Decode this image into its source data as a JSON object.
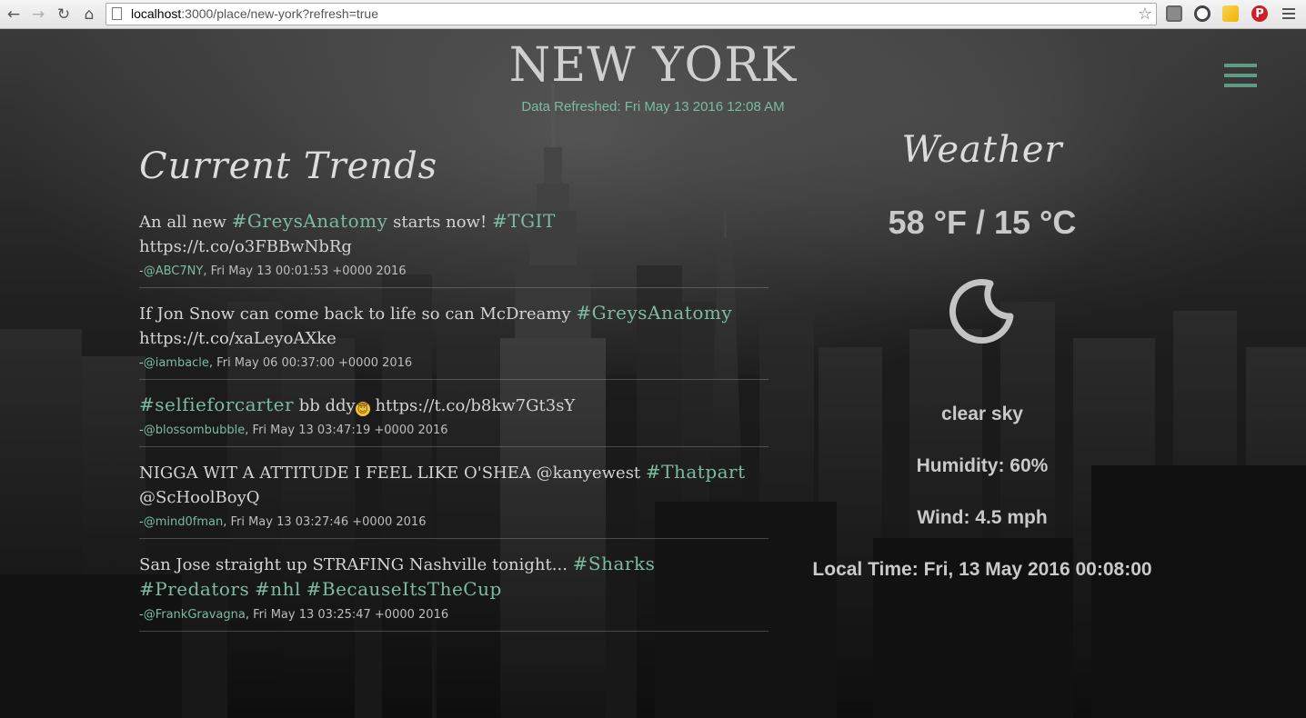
{
  "browser": {
    "url_host": "localhost",
    "url_path": ":3000/place/new-york?refresh=true",
    "back_icon": "arrow-left",
    "forward_icon": "arrow-right",
    "reload_icon": "reload",
    "home_icon": "home",
    "star_icon": "star-outline"
  },
  "header": {
    "city": "NEW YORK",
    "refreshed": "Data Refreshed: Fri May 13 2016 12:08 AM"
  },
  "trends": {
    "heading": "Current Trends",
    "tweets": [
      {
        "parts": [
          {
            "t": "An all new "
          },
          {
            "t": "#GreysAnatomy",
            "tag": true
          },
          {
            "t": " starts now! "
          },
          {
            "t": "#TGIT",
            "tag": true
          },
          {
            "t": " https://t.co/o3FBBwNbRg"
          }
        ],
        "user": "@ABC7NY",
        "date": ", Fri May 13 00:01:53 +0000 2016"
      },
      {
        "parts": [
          {
            "t": "If Jon Snow can come back to life so can McDreamy "
          },
          {
            "t": "#GreysAnatomy",
            "tag": true
          },
          {
            "t": " https://t.co/xaLeyoAXke"
          }
        ],
        "user": "@iambacle",
        "date": ", Fri May 06 00:37:00 +0000 2016"
      },
      {
        "parts": [
          {
            "t": "#selfieforcarter",
            "tag": true
          },
          {
            "t": " bb ddy"
          },
          {
            "t": "😇",
            "emoji": true
          },
          {
            "t": " https://t.co/b8kw7Gt3sY"
          }
        ],
        "user": "@blossombubble",
        "date": ", Fri May 13 03:47:19 +0000 2016"
      },
      {
        "parts": [
          {
            "t": "NIGGA WIT A ATTITUDE I FEEL LIKE O'SHEA @kanyewest "
          },
          {
            "t": "#Thatpart",
            "tag": true
          },
          {
            "t": " @ScHoolBoyQ"
          }
        ],
        "user": "@mind0fman",
        "date": ", Fri May 13 03:27:46 +0000 2016"
      },
      {
        "parts": [
          {
            "t": "San Jose straight up STRAFING Nashville tonight... "
          },
          {
            "t": "#Sharks",
            "tag": true
          },
          {
            "t": " "
          },
          {
            "t": "#Predators",
            "tag": true
          },
          {
            "t": " "
          },
          {
            "t": "#nhl",
            "tag": true
          },
          {
            "t": " "
          },
          {
            "t": "#BecauseItsTheCup",
            "tag": true
          }
        ],
        "user": "@FrankGravagna",
        "date": ", Fri May 13 03:25:47 +0000 2016"
      }
    ]
  },
  "weather": {
    "heading": "Weather",
    "temp": "58 °F / 15 °C",
    "icon": "moon-crescent-icon",
    "condition": "clear sky",
    "humidity": "Humidity: 60%",
    "wind": "Wind: 4.5 mph",
    "local_time": "Local Time: Fri, 13 May 2016 00:08:00"
  },
  "colors": {
    "accent": "#7bbba0",
    "menu": "#5f9a82"
  }
}
